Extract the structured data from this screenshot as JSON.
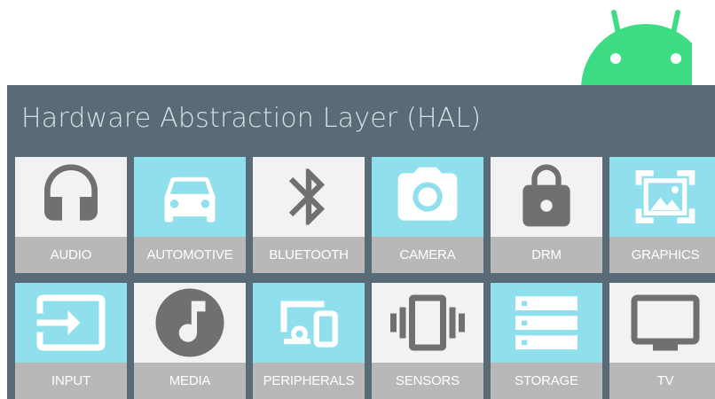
{
  "hal": {
    "title": "Hardware Abstraction Layer (HAL)",
    "tiles": [
      {
        "label": "AUDIO",
        "icon": "headphones-icon"
      },
      {
        "label": "AUTOMOTIVE",
        "icon": "car-icon"
      },
      {
        "label": "BLUETOOTH",
        "icon": "bluetooth-icon"
      },
      {
        "label": "CAMERA",
        "icon": "camera-icon"
      },
      {
        "label": "DRM",
        "icon": "lock-icon"
      },
      {
        "label": "GRAPHICS",
        "icon": "image-frame-icon"
      },
      {
        "label": "INPUT",
        "icon": "input-icon"
      },
      {
        "label": "MEDIA",
        "icon": "music-note-icon"
      },
      {
        "label": "PERIPHERALS",
        "icon": "devices-icon"
      },
      {
        "label": "SENSORS",
        "icon": "vibration-icon"
      },
      {
        "label": "STORAGE",
        "icon": "storage-icon"
      },
      {
        "label": "TV",
        "icon": "tv-icon"
      }
    ]
  },
  "colors": {
    "panel": "#596b76",
    "tile_light": "#f2f2f2",
    "tile_accent": "#8fe0ec",
    "label_bar": "#b8b8b8",
    "icon_dark": "#707070",
    "android_green": "#3ddc84"
  }
}
